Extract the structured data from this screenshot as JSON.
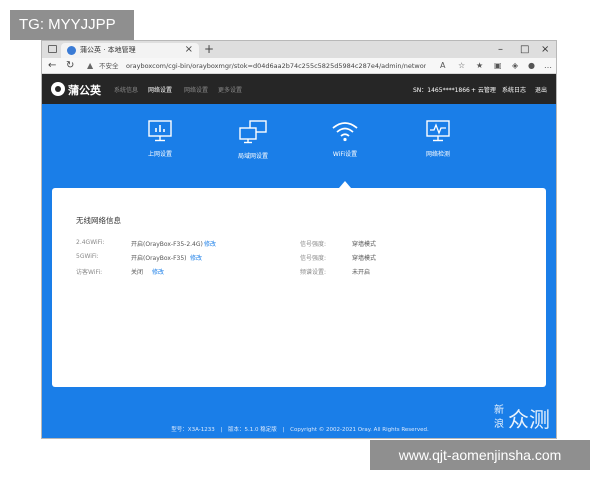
{
  "watermarks": {
    "top_left": "TG: MYYJJPP",
    "bottom_right": "www.qjt-aomenjinsha.com"
  },
  "browser": {
    "tab_title": "蒲公英 · 本地管理",
    "security_label": "不安全",
    "url": "orayboxcom/cgi-bin/orayboxmgr/stok=d04d6aa2b74c255c5825d5984c287e4/admin/network/wifi"
  },
  "app": {
    "brand": "蒲公英",
    "nav": [
      "系统信息",
      "网络设置",
      "网络设置",
      "更多设置"
    ],
    "sn": "SN：1465****1866",
    "cloud": "+ 云管理",
    "logs": "系统日志",
    "logout": "退出"
  },
  "categories": [
    {
      "label": "上网设置",
      "icon": "monitor-chart-icon"
    },
    {
      "label": "局域网设置",
      "icon": "lan-monitors-icon"
    },
    {
      "label": "WiFi设置",
      "icon": "wifi-icon"
    },
    {
      "label": "网络检测",
      "icon": "network-monitor-icon"
    }
  ],
  "active_category": "WiFi设置",
  "card": {
    "title": "无线网络信息",
    "left": [
      {
        "label": "2.4GWiFi:",
        "value": "开启(OrayBox-F35-2.4G)",
        "action": "修改"
      },
      {
        "label": "5GWiFi:",
        "value": "开启(OrayBox-F35)",
        "action": "修改"
      },
      {
        "label": "访客WiFi:",
        "value": "关闭",
        "action": "修改"
      }
    ],
    "right": [
      {
        "label": "信号强度:",
        "value": "穿墙模式"
      },
      {
        "label": "信号强度:",
        "value": "穿墙模式"
      },
      {
        "label": "频谱设置:",
        "value": "未开启"
      }
    ]
  },
  "footer": {
    "model": "型号：X3A-1233",
    "version": "版本：5.1.0 稳定版",
    "copyright": "Copyright © 2002-2021 Oray. All Rights Reserved."
  },
  "sina_watermark": {
    "top": "新",
    "bottom": "浪",
    "main": "众测"
  },
  "colors": {
    "accent": "#1a7ee8",
    "header": "#262626",
    "link": "#1a7ee8"
  }
}
